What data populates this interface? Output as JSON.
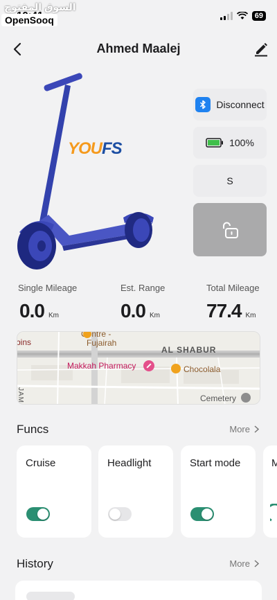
{
  "status_bar": {
    "time": "10:41",
    "battery_level": "69",
    "watermark_arabic": "السوق المفتوح",
    "watermark_brand": "OpenSooq"
  },
  "header": {
    "title": "Ahmed Maalej",
    "back_icon": "chevron-left-icon",
    "edit_icon": "pencil-icon"
  },
  "scooter": {
    "brand_part1": "YOU",
    "brand_part2": "FS",
    "colors": {
      "body": "#3b47b8",
      "logo_orange": "#f59a1d",
      "logo_blue": "#1d4fa3"
    }
  },
  "controls": {
    "disconnect_label": "Disconnect",
    "battery_label": "100%",
    "battery_level": 1.0,
    "speed_mode_label": "S",
    "lock_icon": "unlock-icon"
  },
  "stats": [
    {
      "label": "Single Mileage",
      "value": "0.0",
      "unit": "Km"
    },
    {
      "label": "Est. Range",
      "value": "0.0",
      "unit": "Km"
    },
    {
      "label": "Total Mileage",
      "value": "77.4",
      "unit": "Km"
    }
  ],
  "map": {
    "labels": {
      "centre": "Centre -",
      "fujairah": "Fujairah",
      "bins": "bins",
      "al_shabur": "AL SHABUR",
      "pharmacy": "Makkah Pharmacy",
      "chocolala": "Chocolala",
      "jamal": "JAMAL ABD",
      "cemetery": "Cemetery"
    }
  },
  "funcs": {
    "title": "Funcs",
    "more_label": "More",
    "items": [
      {
        "label": "Cruise",
        "on": true
      },
      {
        "label": "Headlight",
        "on": false
      },
      {
        "label": "Start mode",
        "on": true
      },
      {
        "label": "M"
      }
    ]
  },
  "history": {
    "title": "History",
    "more_label": "More"
  },
  "colors": {
    "accent_green": "#2b8f72",
    "bluetooth_blue": "#1f82f0",
    "background": "#f2f2f3"
  }
}
